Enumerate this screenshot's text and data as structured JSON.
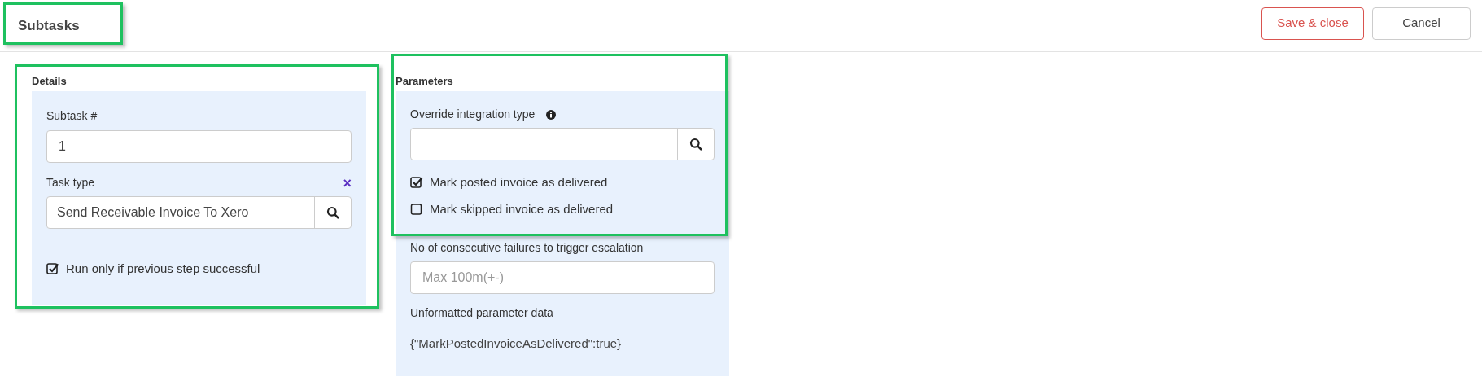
{
  "header": {
    "title": "Subtasks",
    "highlighted": true,
    "buttons": [
      {
        "label": "Save & close",
        "kind": "primary"
      },
      {
        "label": "Cancel",
        "kind": "secondary"
      }
    ]
  },
  "details": {
    "heading": "Details",
    "highlighted": true,
    "subtask_number": {
      "label": "Subtask #",
      "value": "1"
    },
    "task_type": {
      "label": "Task type",
      "clear": "×",
      "value": "Send Receivable Invoice To Xero"
    },
    "options": [
      {
        "label": "Run only if previous step successful",
        "checked": true
      }
    ]
  },
  "parameters": {
    "heading": "Parameters",
    "highlighted": true,
    "override_integration_type": {
      "label": "Override integration type"
    },
    "options": [
      {
        "label": "Mark posted invoice as delivered",
        "checked": true
      },
      {
        "label": "Mark skipped invoice as delivered",
        "checked": false
      }
    ],
    "escalation": {
      "label": "No of consecutive failures to trigger escalation",
      "placeholder": "Max 100m(+-)"
    },
    "unformatted": {
      "label": "Unformatted parameter data",
      "value": "{\"MarkPostedInvoiceAsDelivered\":true}"
    }
  }
}
